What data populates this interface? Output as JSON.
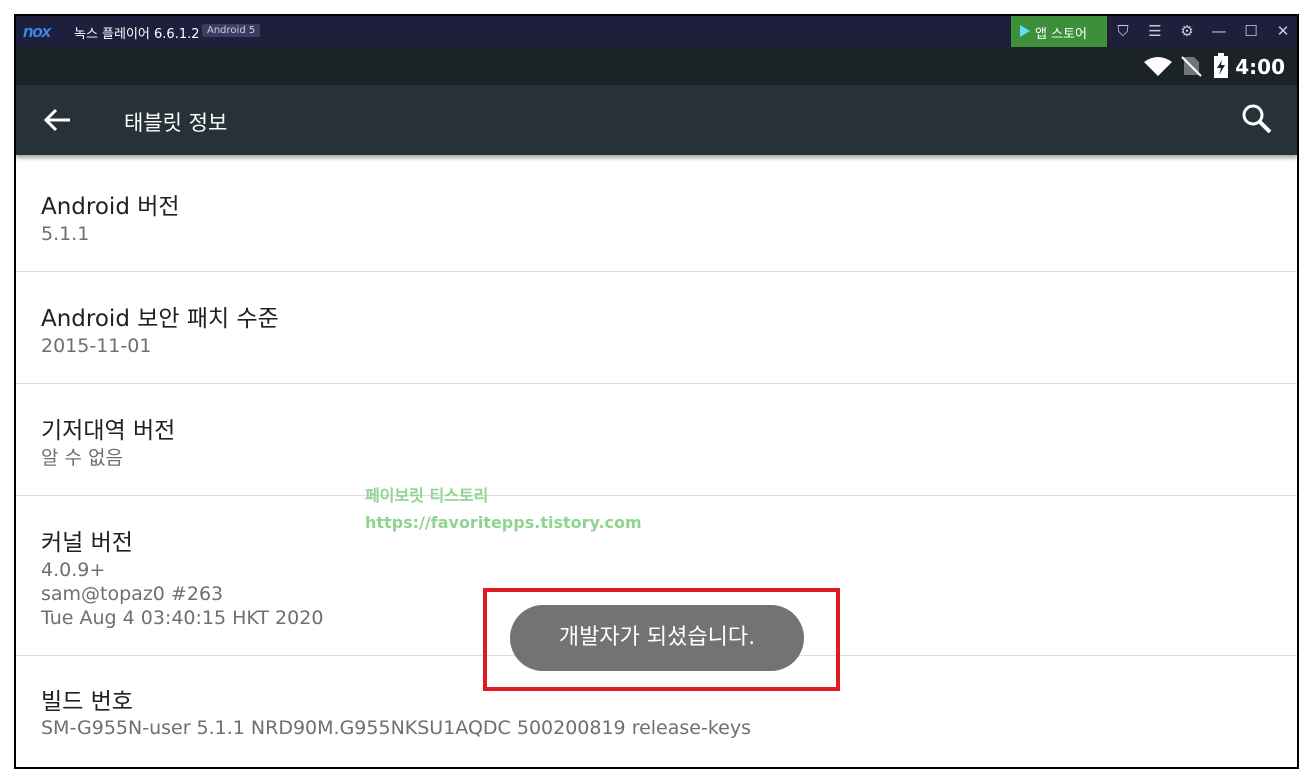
{
  "emulator": {
    "logo": "nox",
    "title": "녹스 플레이어 6.6.1.2",
    "badge": "Android 5",
    "store_label": "앱 스토어",
    "icons": [
      "shirt-icon",
      "menu-icon",
      "gear-icon",
      "minimize-icon",
      "maximize-icon",
      "close-icon"
    ],
    "icon_glyphs": [
      "⛉",
      "☰",
      "⚙",
      "—",
      "☐",
      "✕"
    ]
  },
  "status_bar": {
    "time": "4:00",
    "icons": [
      "wifi-icon",
      "no-sim-icon",
      "battery-charging-icon"
    ]
  },
  "app_bar": {
    "title": "태블릿 정보"
  },
  "items": [
    {
      "title": "Android 버전",
      "summary": [
        "5.1.1"
      ]
    },
    {
      "title": "Android 보안 패치 수준",
      "summary": [
        "2015-11-01"
      ]
    },
    {
      "title": "기저대역 버전",
      "summary": [
        "알 수 없음"
      ]
    },
    {
      "title": "커널 버전",
      "summary": [
        "4.0.9+",
        "sam@topaz0 #263",
        "Tue Aug 4 03:40:15 HKT 2020"
      ]
    },
    {
      "title": "빌드 번호",
      "summary": [
        "SM-G955N-user 5.1.1 NRD90M.G955NKSU1AQDC 500200819 release-keys"
      ]
    }
  ],
  "watermark": {
    "line1": "페이보릿 티스토리",
    "line2": "https://favoritepps.tistory.com"
  },
  "toast": {
    "text": "개발자가 되셨습니다."
  },
  "colors": {
    "emulator_bar": "#1d1f3d",
    "store_button": "#3d8f39",
    "app_bar": "#263238",
    "highlight": "#e01b24"
  }
}
